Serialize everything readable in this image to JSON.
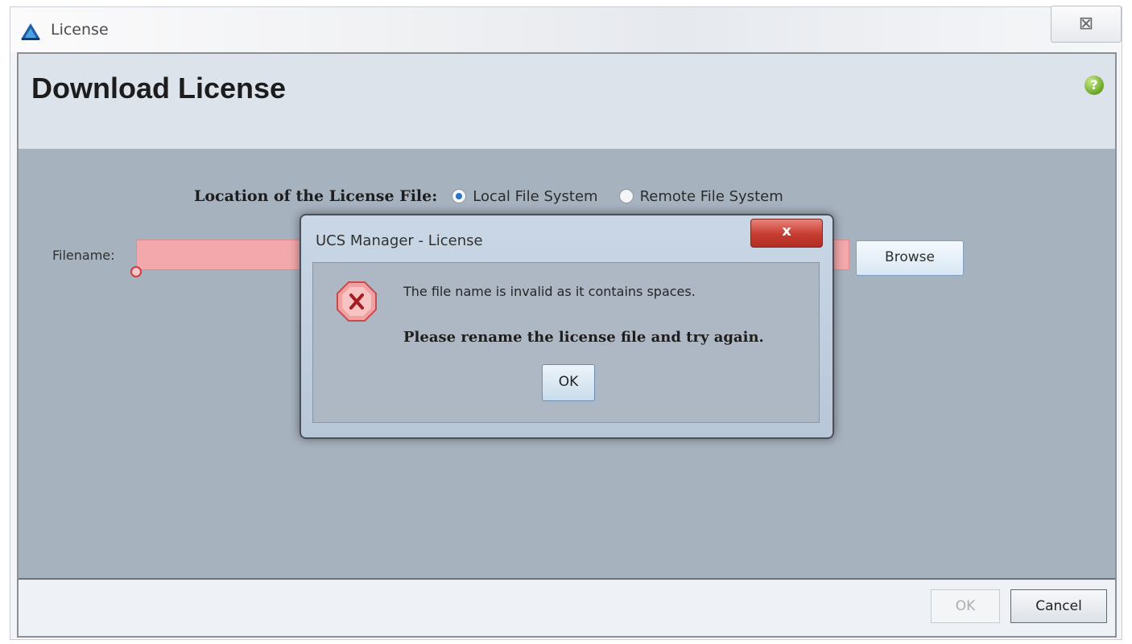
{
  "window": {
    "title": "License",
    "close_symbol": "⊠",
    "icons": {
      "app": "license-app-icon",
      "close": "close-icon"
    }
  },
  "header": {
    "title": "Download License",
    "help_icon": "help-icon",
    "help_symbol": "?"
  },
  "form": {
    "location_label": "Location of the License File:",
    "location_options": [
      {
        "label": "Local File System",
        "selected": true
      },
      {
        "label": "Remote File System",
        "selected": false
      }
    ],
    "filename_label": "Filename:",
    "filename_value": "",
    "filename_state": "error",
    "browse_label": "Browse"
  },
  "footer": {
    "ok_label": "OK",
    "ok_enabled": false,
    "cancel_label": "Cancel"
  },
  "dialog": {
    "title": "UCS Manager - License",
    "close_symbol": "x",
    "message": "The file name is invalid as it contains spaces.",
    "instruction": "Please rename the license file and try again.",
    "ok_label": "OK",
    "icon": "error-octagon-icon"
  },
  "colors": {
    "error_field": "#f3a8ab",
    "panel": "#a7b2bf",
    "header": "#dce3ea",
    "dialog_close": "#c63b2f",
    "help": "#6ca526"
  }
}
